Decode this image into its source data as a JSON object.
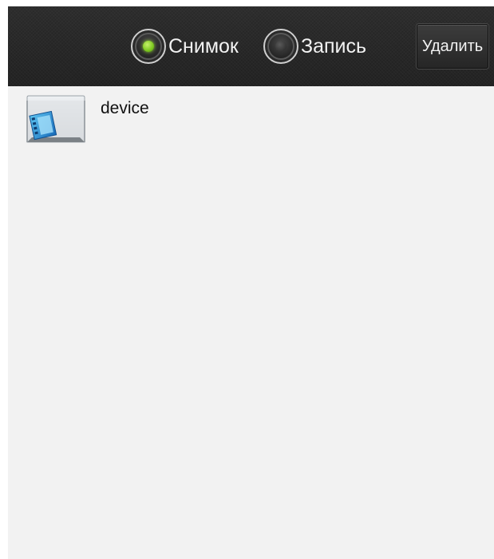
{
  "toolbar": {
    "snapshot_label": "Снимок",
    "record_label": "Запись",
    "delete_label": "Удалить",
    "selected_mode": "Снимок"
  },
  "files": {
    "items": [
      {
        "label": "device",
        "icon": "video-folder-icon"
      }
    ]
  },
  "colors": {
    "toolbar_bg": "#2a2a2a",
    "content_bg": "#f2f2f2",
    "radio_active": "#7cc71f"
  }
}
